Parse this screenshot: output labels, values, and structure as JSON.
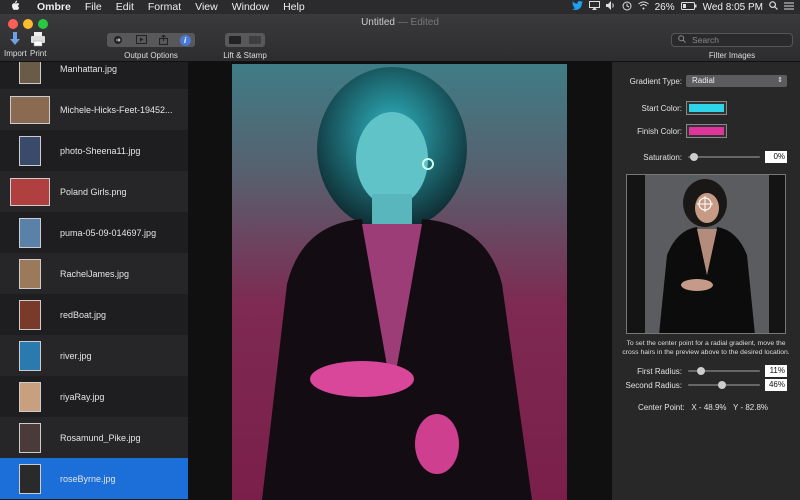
{
  "menubar": {
    "app_name": "Ombre",
    "items": [
      "File",
      "Edit",
      "Format",
      "View",
      "Window",
      "Help"
    ],
    "battery": "26%",
    "clock": "Wed 8:05 PM",
    "icons": [
      "apple-icon",
      "twitter-icon",
      "airplay-icon",
      "volume-icon",
      "time-machine-icon",
      "wifi-icon",
      "battery-icon",
      "spotlight-icon",
      "list-icon"
    ]
  },
  "window": {
    "title": "Untitled",
    "title_suffix": "— Edited"
  },
  "toolbar": {
    "import_label": "Import",
    "print_label": "Print",
    "output_options_label": "Output Options",
    "lift_stamp_label": "Lift & Stamp",
    "filter_images_label": "Filter Images",
    "info_glyph": "i"
  },
  "search": {
    "placeholder": "Search"
  },
  "files": [
    {
      "name": "Manhattan.jpg",
      "thumb_color": "#6a5a48"
    },
    {
      "name": "Michele-Hicks-Feet-19452...",
      "thumb_color": "#8a6a50"
    },
    {
      "name": "photo-Sheena11.jpg",
      "thumb_color": "#3a4a6a"
    },
    {
      "name": "Poland Girls.png",
      "thumb_color": "#b04040"
    },
    {
      "name": "puma-05-09-014697.jpg",
      "thumb_color": "#5a82a8"
    },
    {
      "name": "RachelJames.jpg",
      "thumb_color": "#9a7a5a"
    },
    {
      "name": "redBoat.jpg",
      "thumb_color": "#7a3a2a"
    },
    {
      "name": "river.jpg",
      "thumb_color": "#2a7ab0"
    },
    {
      "name": "riyaRay.jpg",
      "thumb_color": "#c8a080"
    },
    {
      "name": "Rosamund_Pike.jpg",
      "thumb_color": "#4a3a3a"
    },
    {
      "name": "roseByrne.jpg",
      "thumb_color": "#2a2a2a"
    }
  ],
  "selected_file": "roseByrne.jpg",
  "settings": {
    "gradient_type_label": "Gradient Type:",
    "gradient_type_value": "Radial",
    "start_color_label": "Start Color:",
    "start_color": "#2ed4ea",
    "finish_color_label": "Finish Color:",
    "finish_color": "#e0349c",
    "saturation_label": "Saturation:",
    "saturation_value": "0%",
    "saturation_fraction": 0.0,
    "help_text": "To set the center point  for a radial gradient, move the cross hairs in the preview above to the desired location.",
    "first_radius_label": "First Radius:",
    "first_radius_value": "11%",
    "first_radius_fraction": 0.11,
    "second_radius_label": "Second Radius:",
    "second_radius_value": "46%",
    "second_radius_fraction": 0.46,
    "center_point_label": "Center Point:",
    "center_point_x": "X - 48.9%",
    "center_point_y": "Y - 82.8%"
  },
  "colors": {
    "selection_blue": "#1c6fd9",
    "info_blue": "#4a78d6",
    "twitter_blue": "#1da1f2"
  }
}
